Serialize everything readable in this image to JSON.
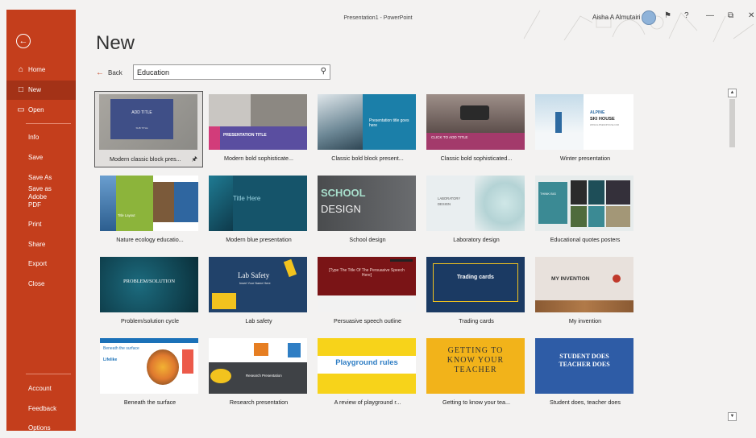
{
  "window": {
    "title": "Presentation1 - PowerPoint",
    "user": "Aisha A Almutairi"
  },
  "sidebar": {
    "items": [
      {
        "label": "Home",
        "icon": "home-icon"
      },
      {
        "label": "New",
        "icon": "new-document-icon"
      },
      {
        "label": "Open",
        "icon": "folder-open-icon"
      },
      {
        "label": "Info"
      },
      {
        "label": "Save"
      },
      {
        "label": "Save As"
      },
      {
        "label": "Save as Adobe PDF"
      },
      {
        "label": "Print"
      },
      {
        "label": "Share"
      },
      {
        "label": "Export"
      },
      {
        "label": "Close"
      },
      {
        "label": "Account"
      },
      {
        "label": "Feedback"
      },
      {
        "label": "Options"
      }
    ]
  },
  "main": {
    "title": "New",
    "back_label": "Back",
    "search": {
      "value": "Education"
    },
    "templates": [
      {
        "name": "Modern classic block pres...",
        "thumb": {
          "line1": "ADD TITLE",
          "line2": "SUB TITLE"
        }
      },
      {
        "name": "Modern bold sophisticate...",
        "thumb": {
          "line1": "PRESENTATION TITLE"
        }
      },
      {
        "name": "Classic bold block present...",
        "thumb": {
          "line1": "Presentation title goes here"
        }
      },
      {
        "name": "Classic bold sophisticated...",
        "thumb": {
          "line1": "CLICK TO ADD TITLE"
        }
      },
      {
        "name": "Winter presentation",
        "thumb": {
          "line1": "ALPINE",
          "line2": "SKI HOUSE",
          "line3": "WWW.ALPINESKIHOUSE.COM"
        }
      },
      {
        "name": "Nature ecology educatio...",
        "thumb": {
          "line1": "Title Layout"
        }
      },
      {
        "name": "Modern blue presentation",
        "thumb": {
          "line1": "Title Here"
        }
      },
      {
        "name": "School design",
        "thumb": {
          "line1": "SCHOOL",
          "line2": "DESIGN"
        }
      },
      {
        "name": "Laboratory design",
        "thumb": {
          "line1": "LABORATORY",
          "line2": "DESIGN"
        }
      },
      {
        "name": "Educational quotes posters",
        "thumb": {
          "line1": "THINK BIG"
        }
      },
      {
        "name": "Problem/solution cycle",
        "thumb": {
          "line1": "PROBLEM/SOLUTION"
        }
      },
      {
        "name": "Lab safety",
        "thumb": {
          "line1": "Lab Safety",
          "line2": "Insert Your Name Here"
        }
      },
      {
        "name": "Persuasive speech outline",
        "thumb": {
          "line1": "[Type The Title Of The Persuasive Speech Here]"
        }
      },
      {
        "name": "Trading cards",
        "thumb": {
          "line1": "Trading cards"
        }
      },
      {
        "name": "My invention",
        "thumb": {
          "line1": "MY INVENTION"
        }
      },
      {
        "name": "Beneath the surface",
        "thumb": {
          "line1": "Beneath the surface",
          "line2": "Lifelike"
        }
      },
      {
        "name": "Research presentation",
        "thumb": {
          "line1": "Research Presentation"
        }
      },
      {
        "name": "A review of playground r...",
        "thumb": {
          "line1": "Playground rules"
        }
      },
      {
        "name": "Getting to know your tea...",
        "thumb": {
          "line1": "GETTING TO KNOW YOUR TEACHER"
        }
      },
      {
        "name": "Student does, teacher does",
        "thumb": {
          "line1": "STUDENT DOES TEACHER DOES"
        }
      }
    ]
  },
  "colors": {
    "accent": "#c43e1c",
    "accent_active": "#a33217",
    "background": "#f3f2f1"
  }
}
